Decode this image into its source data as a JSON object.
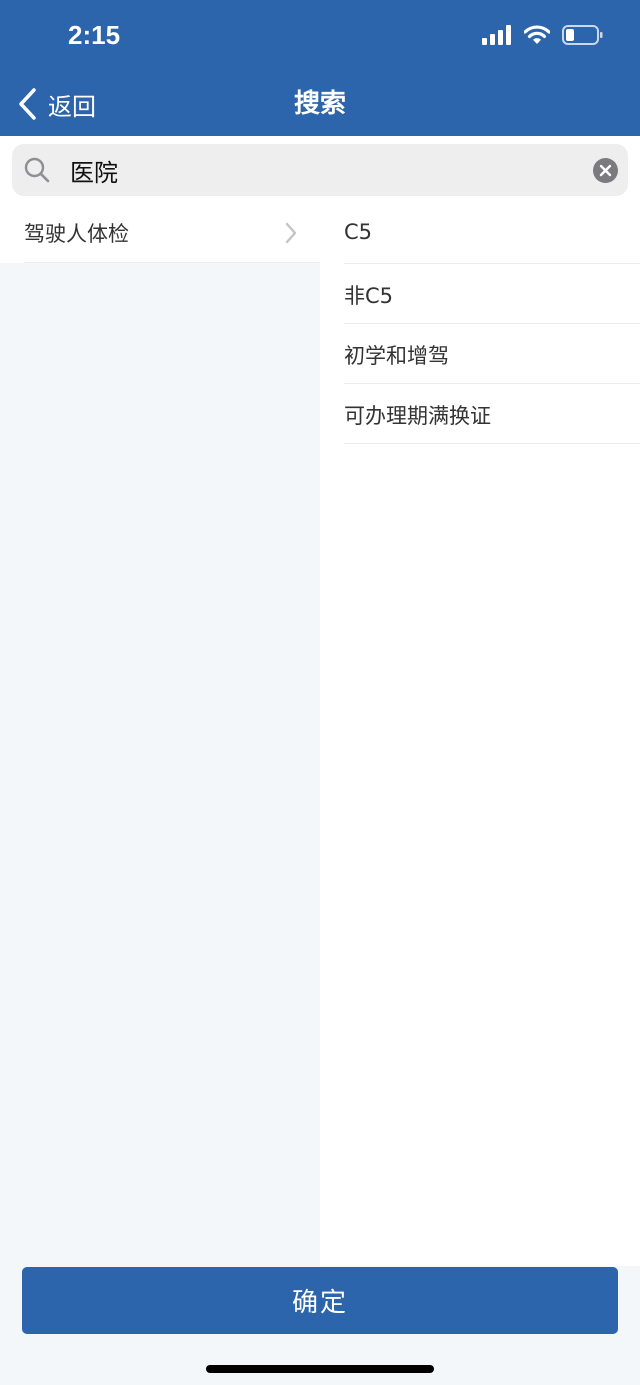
{
  "status_bar": {
    "time": "2:15"
  },
  "nav": {
    "back_label": "返回",
    "title": "搜索"
  },
  "search": {
    "value": "医院"
  },
  "categories": [
    {
      "label": "驾驶人体检"
    }
  ],
  "options": [
    {
      "label": "C5"
    },
    {
      "label": "非C5"
    },
    {
      "label": "初学和增驾"
    },
    {
      "label": "可办理期满换证"
    }
  ],
  "confirm_label": "确定",
  "colors": {
    "primary": "#2c65ab",
    "background": "#f3f7f9",
    "search_bg": "#eeeeef"
  }
}
